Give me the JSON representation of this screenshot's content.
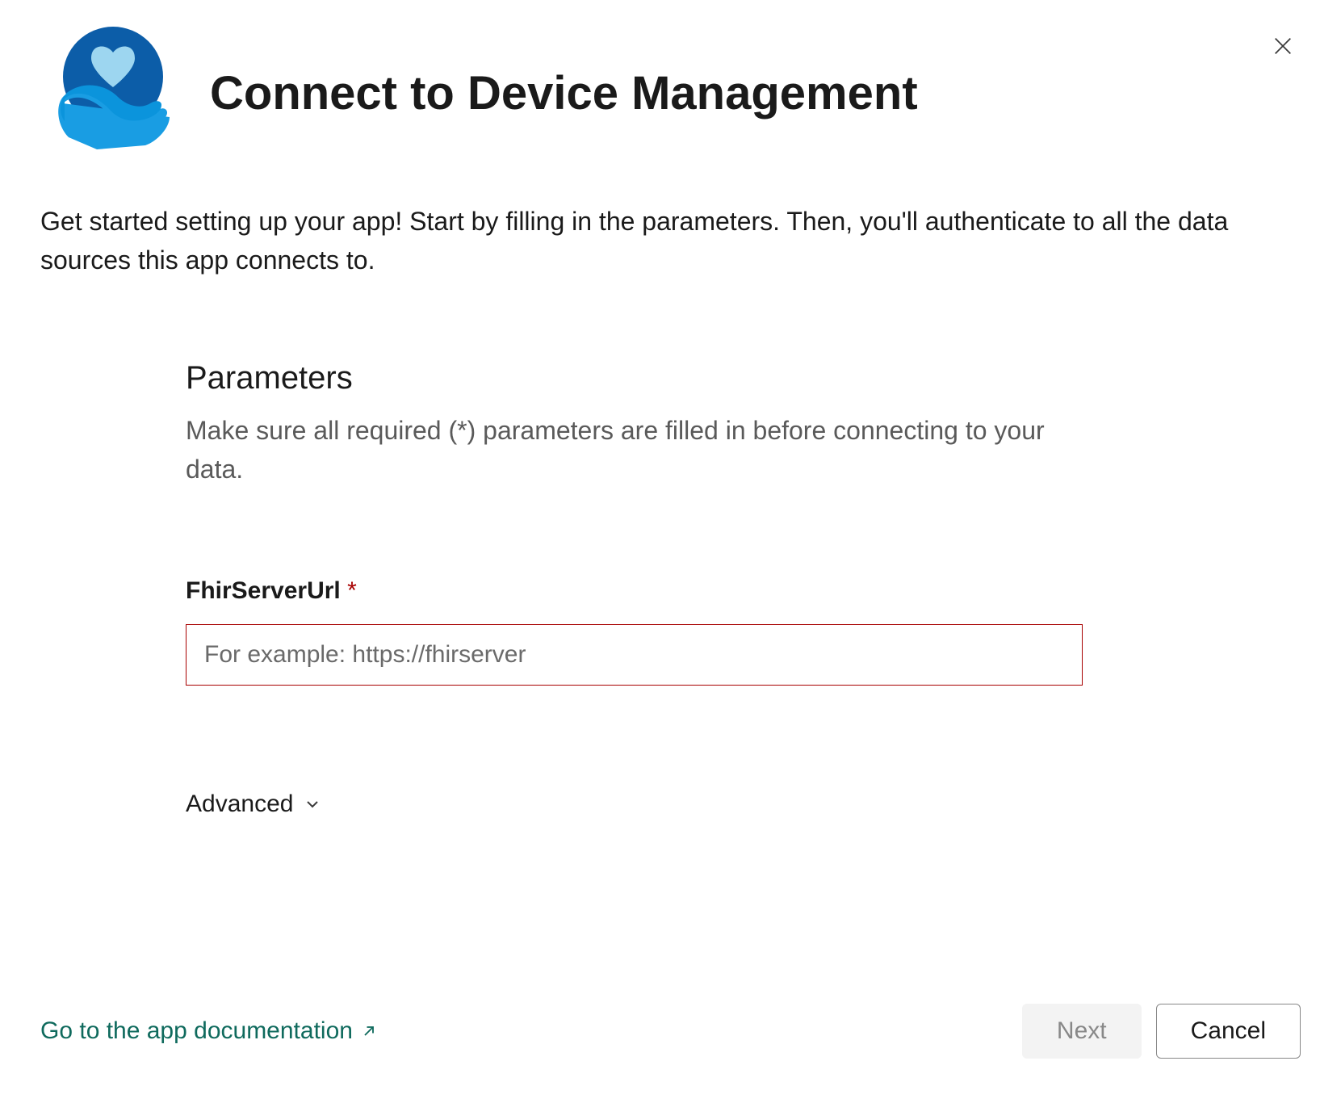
{
  "dialog": {
    "title": "Connect to Device Management",
    "intro": "Get started setting up your app! Start by filling in the parameters. Then, you'll authenticate to all the data sources this app connects to."
  },
  "parameters": {
    "heading": "Parameters",
    "description": "Make sure all required (*) parameters are filled in before connecting to your data.",
    "fields": {
      "fhir": {
        "label": "FhirServerUrl",
        "required": "*",
        "placeholder": "For example: https://fhirserver",
        "value": ""
      }
    },
    "advanced_label": "Advanced"
  },
  "footer": {
    "doc_link": "Go to the app documentation",
    "next_label": "Next",
    "cancel_label": "Cancel"
  }
}
